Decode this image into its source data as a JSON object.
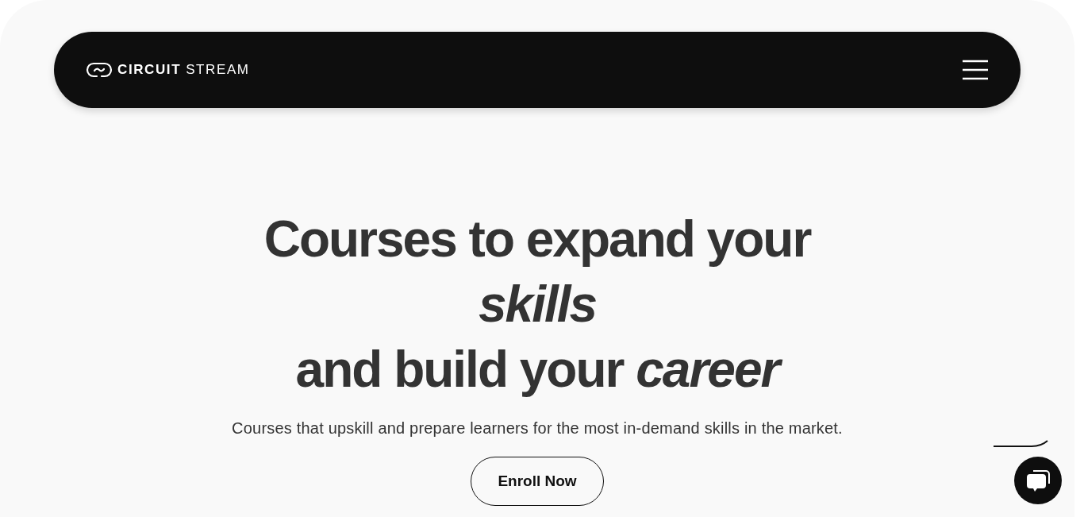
{
  "navbar": {
    "logo_bold": "CIRCUIT",
    "logo_light": "STREAM"
  },
  "hero": {
    "heading_lines": [
      "Courses to expand your",
      "*skills*",
      "and build your *career*"
    ],
    "subtitle": "Courses that upskill and prepare learners for the most in-demand skills in the market.",
    "button": "Enroll Now"
  }
}
